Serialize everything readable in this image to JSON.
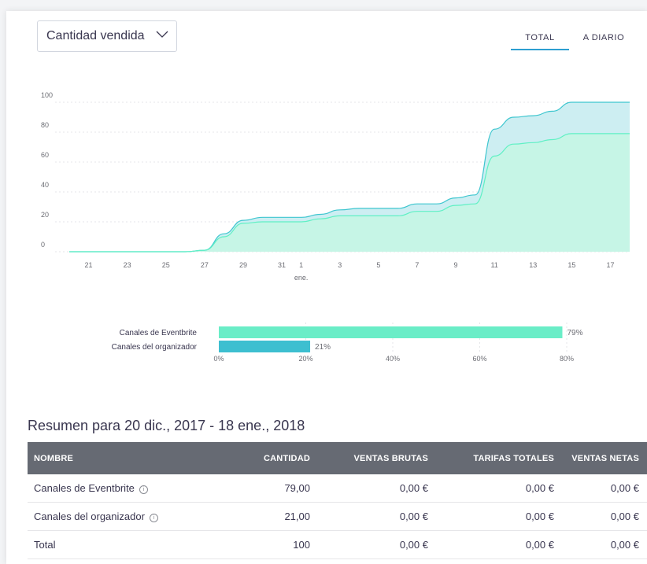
{
  "controls": {
    "metric_dropdown": "Cantidad vendida",
    "tabs": [
      {
        "label": "TOTAL",
        "active": true
      },
      {
        "label": "A DIARIO",
        "active": false
      }
    ]
  },
  "chart_data": [
    {
      "type": "area",
      "x_tick_labels": [
        "21",
        "23",
        "25",
        "27",
        "29",
        "31",
        "1",
        "3",
        "5",
        "7",
        "9",
        "11",
        "13",
        "15",
        "17"
      ],
      "x_sublabel": "ene.",
      "ylim": [
        0,
        100
      ],
      "y_tick_labels": [
        "0",
        "20",
        "40",
        "60",
        "80",
        "100"
      ],
      "x": [
        "2017-12-20",
        "2017-12-21",
        "2017-12-22",
        "2017-12-23",
        "2017-12-24",
        "2017-12-25",
        "2017-12-26",
        "2017-12-27",
        "2017-12-28",
        "2017-12-29",
        "2017-12-30",
        "2017-12-31",
        "2018-01-01",
        "2018-01-02",
        "2018-01-03",
        "2018-01-04",
        "2018-01-05",
        "2018-01-06",
        "2018-01-07",
        "2018-01-08",
        "2018-01-09",
        "2018-01-10",
        "2018-01-11",
        "2018-01-12",
        "2018-01-13",
        "2018-01-14",
        "2018-01-15",
        "2018-01-16",
        "2018-01-17",
        "2018-01-18"
      ],
      "series": [
        {
          "values": [
            0,
            0,
            0,
            0,
            0,
            0,
            0,
            1,
            12,
            21,
            23,
            23,
            23,
            25,
            28,
            29,
            29,
            29,
            32,
            32,
            36,
            38,
            82,
            90,
            91,
            94,
            100,
            100,
            100,
            100
          ],
          "color": "#cdeef2",
          "line_color": "#3ec6cf"
        },
        {
          "values": [
            0,
            0,
            0,
            0,
            0,
            0,
            0,
            1,
            10,
            19,
            20,
            20,
            20,
            22,
            24,
            24,
            24,
            24,
            27,
            27,
            31,
            32,
            64,
            72,
            73,
            75,
            79,
            79,
            79,
            79
          ],
          "color": "#c6f5e6",
          "line_color": "#5ff0c4"
        }
      ],
      "grid": true
    },
    {
      "type": "bar",
      "orientation": "horizontal",
      "categories": [
        "Canales de Eventbrite",
        "Canales del organizador"
      ],
      "values": [
        79,
        21
      ],
      "value_labels": [
        "79%",
        "21%"
      ],
      "x_tick_labels": [
        "0%",
        "20%",
        "40%",
        "60%",
        "80%"
      ],
      "xlim": [
        0,
        80
      ],
      "colors": [
        "#6aedc7",
        "#3dbfd0"
      ]
    }
  ],
  "summary": {
    "title": "Resumen para 20 dic., 2017 - 18 ene., 2018",
    "columns": [
      "NOMBRE",
      "CANTIDAD",
      "VENTAS BRUTAS",
      "TARIFAS TOTALES",
      "VENTAS NETAS"
    ],
    "rows": [
      {
        "name": "Canales de Eventbrite",
        "info_icon": "info-circle-icon",
        "cantidad": "79,00",
        "brutas": "0,00 €",
        "tarifas": "0,00 €",
        "netas": "0,00 €"
      },
      {
        "name": "Canales del organizador",
        "info_icon": "info-circle-icon",
        "cantidad": "21,00",
        "brutas": "0,00 €",
        "tarifas": "0,00 €",
        "netas": "0,00 €"
      },
      {
        "name": "Total",
        "cantidad": "100",
        "brutas": "0,00 €",
        "tarifas": "0,00 €",
        "netas": "0,00 €"
      }
    ],
    "info_glyph": "i"
  }
}
